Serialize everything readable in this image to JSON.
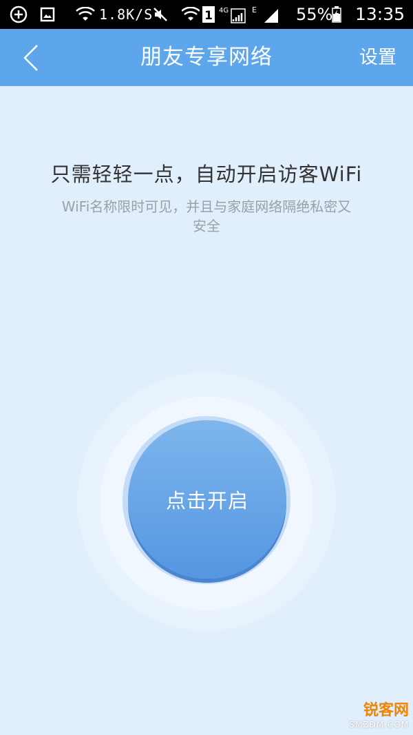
{
  "status_bar": {
    "speed": "1.8K/S",
    "battery": "55%",
    "time": "13:35",
    "icons": [
      "add-circle-icon",
      "image-icon",
      "wifi-icon",
      "mute-icon",
      "wifi-signal-icon",
      "sim-1-icon",
      "signal-4g-icon",
      "signal-e-icon",
      "battery-icon"
    ]
  },
  "header": {
    "title": "朋友专享网络",
    "settings_label": "设置",
    "back_icon": "chevron-left-icon"
  },
  "content": {
    "headline": "只需轻轻一点，自动开启访客WiFi",
    "description": "WiFi名称限时可见，并且与家庭网络隔绝私密又安全",
    "start_button_label": "点击开启"
  },
  "watermark": {
    "logo_text": "锐客网",
    "site": "SMZDM.COM"
  },
  "colors": {
    "header_bg": "#5ea6ec",
    "page_bg": "#e1eefb",
    "button": "#5c9de6"
  }
}
